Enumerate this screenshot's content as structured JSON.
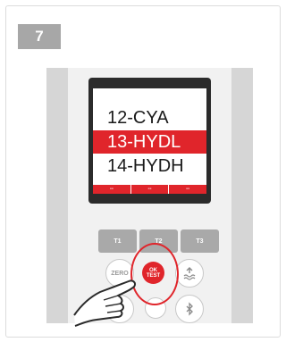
{
  "step": {
    "number": "7"
  },
  "screen": {
    "menu_items": [
      "12-CYA",
      "13-HYDL",
      "14-HYDH"
    ],
    "selected_index": 1,
    "softkeys": [
      "--",
      "--",
      "--"
    ]
  },
  "keypad": {
    "t1_label": "T1",
    "t2_label": "T2",
    "t3_label": "T3",
    "zero_label": "ZERO",
    "ok_label_top": "OK",
    "ok_label_bottom": "TEST"
  },
  "colors": {
    "accent": "#e0252b",
    "badge": "#a7a7a7"
  }
}
